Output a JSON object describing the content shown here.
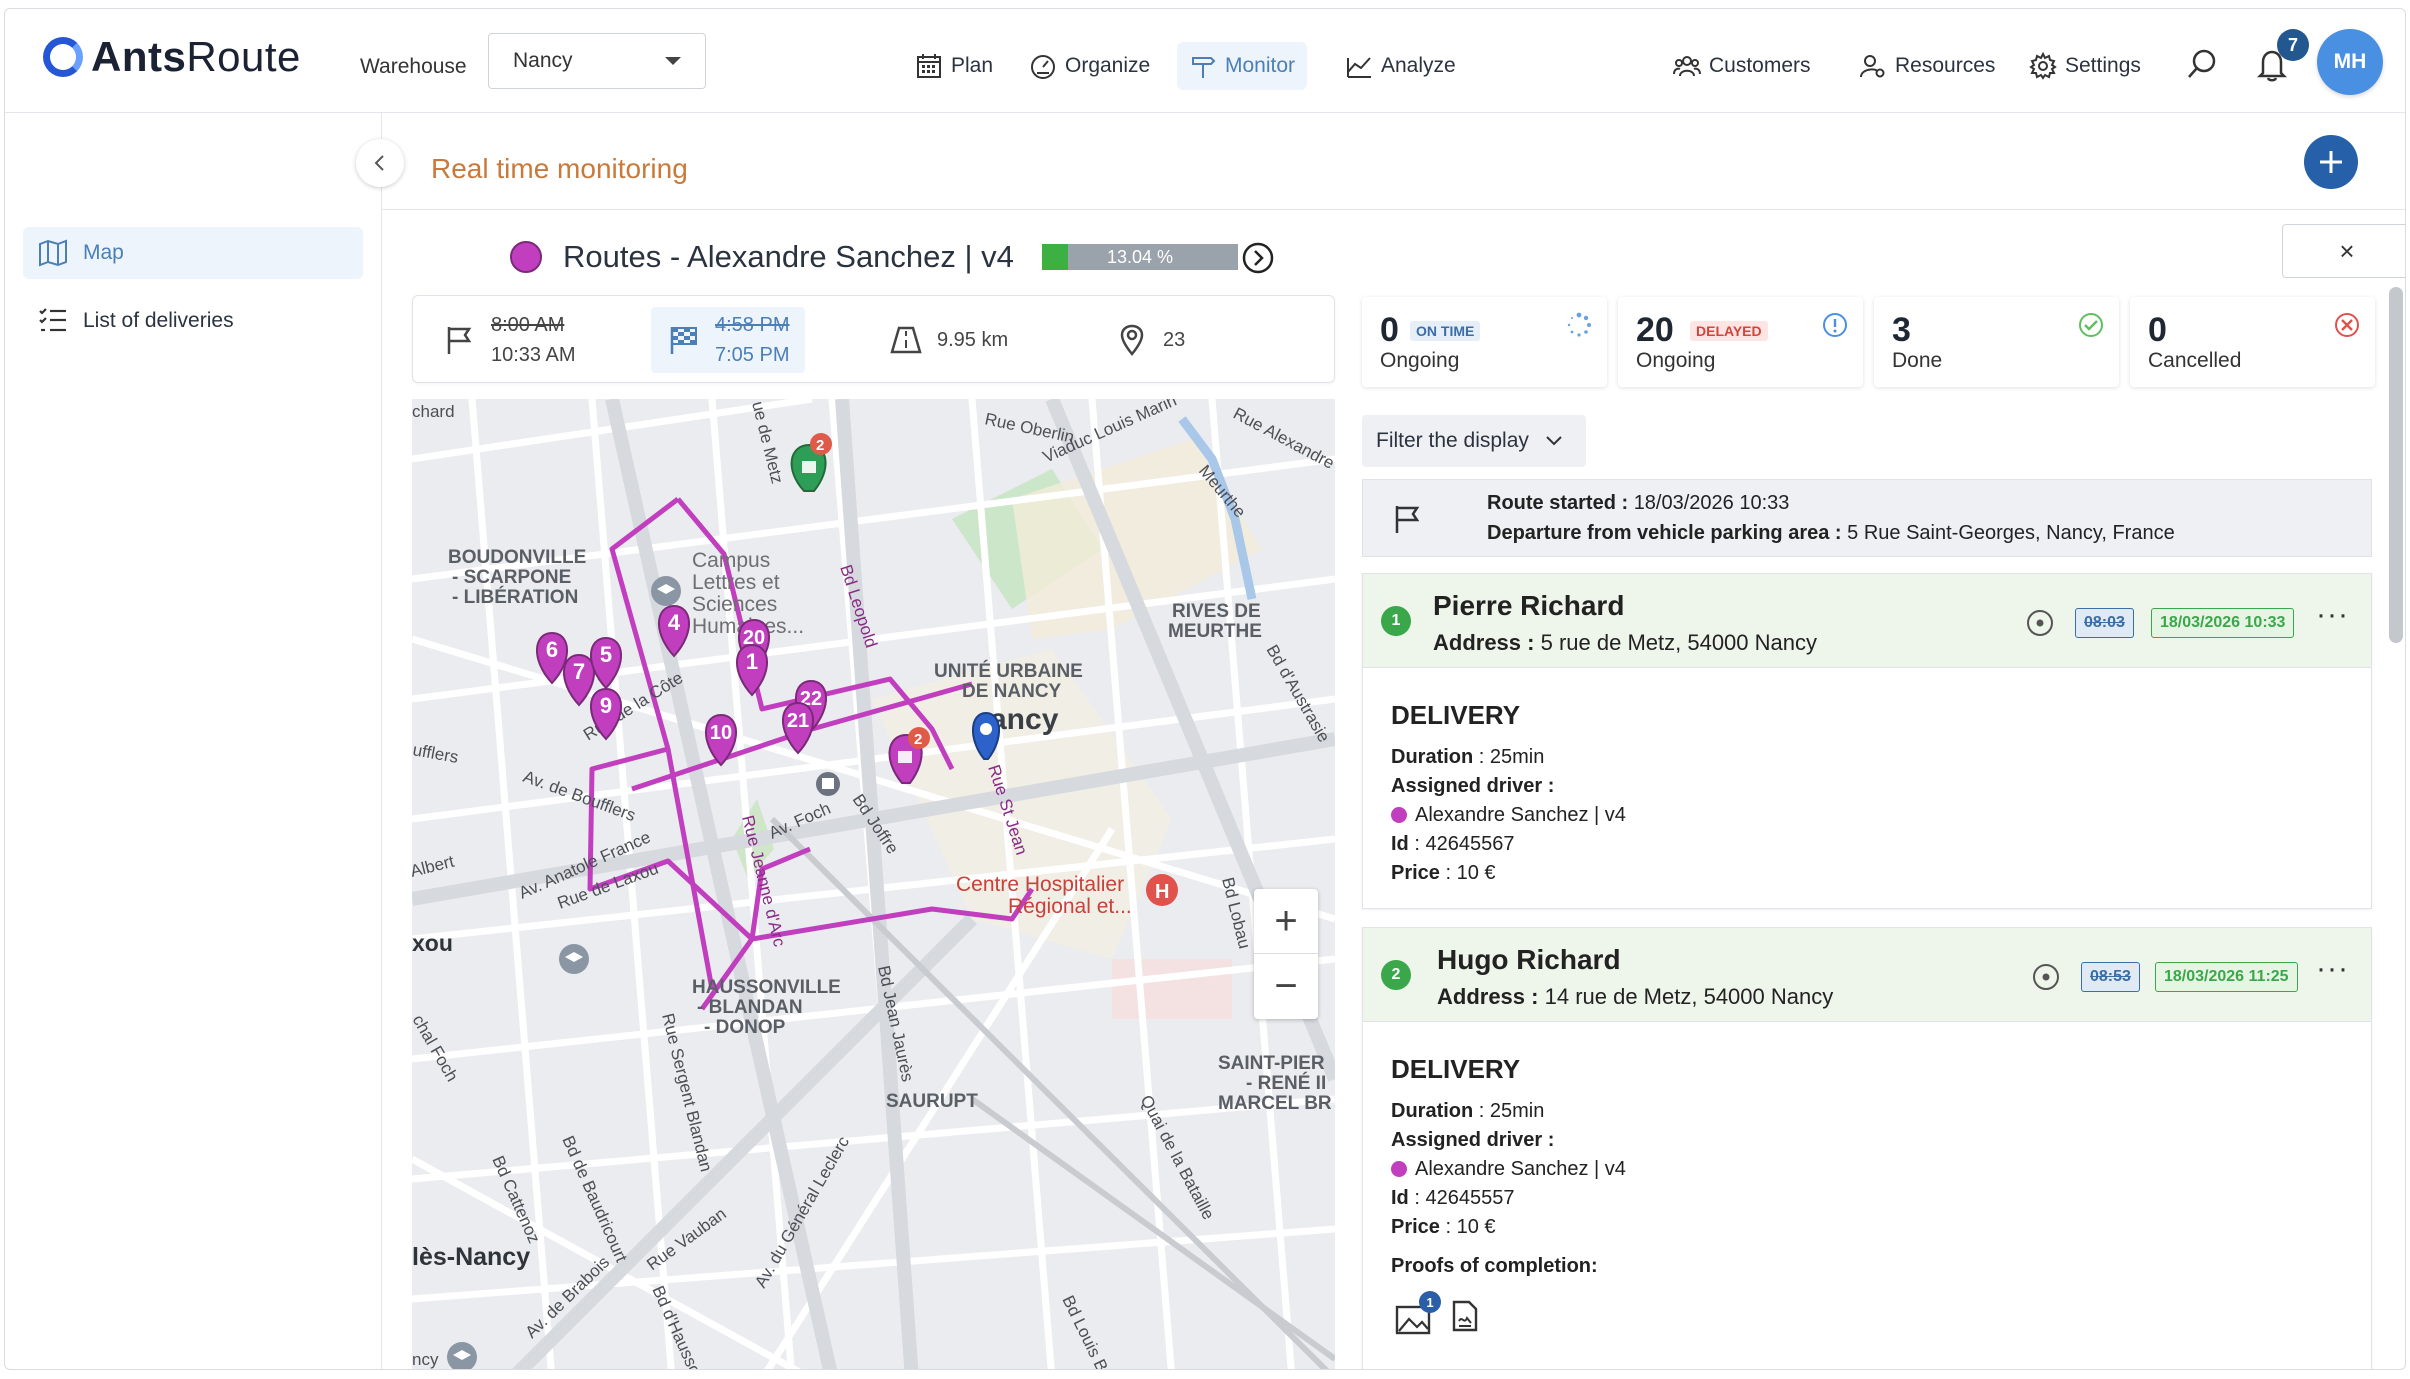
{
  "brand": {
    "name_bold": "Ants",
    "name_rest": "Route"
  },
  "header": {
    "warehouse_label": "Warehouse",
    "warehouse_value": "Nancy",
    "nav": [
      {
        "label": "Plan",
        "icon": "calendar-icon"
      },
      {
        "label": "Organize",
        "icon": "gauge-icon"
      },
      {
        "label": "Monitor",
        "icon": "signpost-icon",
        "active": true
      },
      {
        "label": "Analyze",
        "icon": "chart-icon"
      }
    ],
    "right_nav": [
      {
        "label": "Customers",
        "icon": "customers-icon"
      },
      {
        "label": "Resources",
        "icon": "resources-icon"
      },
      {
        "label": "Settings",
        "icon": "gear-icon"
      }
    ],
    "notifications_count": "7",
    "avatar_initials": "MH"
  },
  "sidebar": {
    "items": [
      {
        "label": "Map",
        "icon": "map-icon",
        "active": true
      },
      {
        "label": "List of deliveries",
        "icon": "list-icon"
      }
    ]
  },
  "page": {
    "title": "Real time monitoring",
    "route_title": "Routes - Alexandre Sanchez | v4",
    "route_color": "#c13fbf",
    "progress_label": "13.04 %",
    "progress_percent": 13.04,
    "close_label": "×"
  },
  "stats": {
    "start_planned": "8:00 AM",
    "start_actual": "10:33 AM",
    "end_planned": "4:58 PM",
    "end_actual": "7:05 PM",
    "distance": "9.95 km",
    "stops": "23"
  },
  "kpis": [
    {
      "value": "0",
      "tag": "ON TIME",
      "label": "Ongoing",
      "icon": "spinner-icon"
    },
    {
      "value": "20",
      "tag": "DELAYED",
      "label": "Ongoing",
      "icon": "info-icon"
    },
    {
      "value": "3",
      "tag": "",
      "label": "Done",
      "icon": "check-circle-icon"
    },
    {
      "value": "0",
      "tag": "",
      "label": "Cancelled",
      "icon": "x-circle-icon"
    }
  ],
  "filter": {
    "label": "Filter the display"
  },
  "route_start": {
    "started_label": "Route started :",
    "started_value": "18/03/2026 10:33",
    "departure_label": "Departure from vehicle parking area :",
    "departure_value": "5 Rue Saint-Georges, Nancy, France"
  },
  "deliveries": [
    {
      "number": "1",
      "name": "Pierre Richard",
      "address_label": "Address :",
      "address": "5 rue de Metz, 54000 Nancy",
      "planned_time": "08:03",
      "actual_time": "18/03/2026 10:33",
      "type": "DELIVERY",
      "duration_label": "Duration",
      "duration": "25min",
      "driver_label": "Assigned driver :",
      "driver": "Alexandre Sanchez | v4",
      "id_label": "Id",
      "id": "42645567",
      "price_label": "Price",
      "price": "10 €"
    },
    {
      "number": "2",
      "name": "Hugo Richard",
      "address_label": "Address :",
      "address": "14 rue de Metz, 54000 Nancy",
      "planned_time": "08:53",
      "actual_time": "18/03/2026 11:25",
      "type": "DELIVERY",
      "duration_label": "Duration",
      "duration": "25min",
      "driver_label": "Assigned driver :",
      "driver": "Alexandre Sanchez | v4",
      "id_label": "Id",
      "id": "42645557",
      "price_label": "Price",
      "price": "10 €",
      "proofs_label": "Proofs of completion:",
      "proofs_photo_count": "1"
    }
  ],
  "map": {
    "labels": [
      "BOUDONVILLE",
      "- SCARPONE",
      "- LIBÉRATION",
      "Campus",
      "Lettres et",
      "Sciences",
      "Humaines...",
      "RIVES DE",
      "MEURTHE",
      "UNITÉ URBAINE",
      "DE NANCY",
      "ancy",
      "HAUSSONVILLE",
      "- BLANDAN",
      "- DONOP",
      "SAURUPT",
      "SAINT-PIER",
      "- RENÉ II",
      "MARCEL BR",
      "Centre Hospitalier",
      "Régional et...",
      "lès-Nancy",
      "xou",
      "Rue Oberlin",
      "Viaduc Louis Marin",
      "Rue Alexandre",
      "Meurthe",
      "Rue de la Côte",
      "Av. de Boufflers",
      "Av. Anatole France",
      "Rue de Laxou",
      "Av. Foch",
      "Bd Joffre",
      "Bd Jean Jaurès",
      "Bd Lobau",
      "Quai de la Bataille",
      "Av. du Général Leclerc",
      "Rue Vauban",
      "Bd d'Haussonville",
      "Bd de Baudricourt",
      "Bd Cattenoz",
      "Av. de Brabois",
      "Rue Sergent Blandan",
      "Bd d'Austrasie",
      "Bd Louis Barthou",
      "chard",
      "ufflers",
      "Albert",
      "chal Foch",
      "Rue Jeanne d'Arc",
      "Bd Leopold",
      "Rue St Jean",
      "ue de Metz",
      "ncy"
    ],
    "markers": [
      "6",
      "7",
      "5",
      "9",
      "4",
      "20",
      "1",
      "22",
      "21",
      "10"
    ],
    "cluster_badges": [
      "2",
      "2"
    ],
    "zoom_in": "+",
    "zoom_out": "−",
    "hospital_glyph": "H"
  }
}
